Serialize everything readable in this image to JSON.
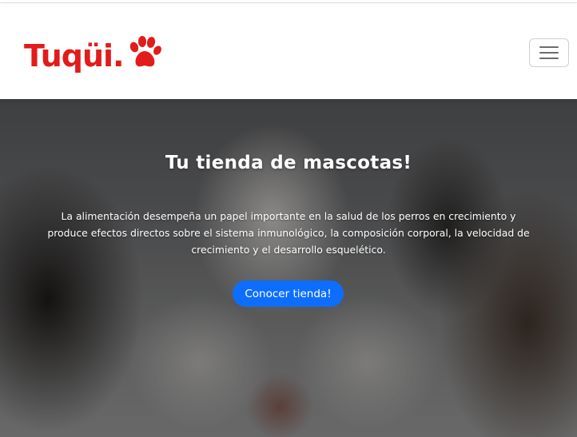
{
  "brand": {
    "name": "Tuqüi.",
    "logo_icon": "paw-icon",
    "color": "#e21b1b"
  },
  "navbar": {
    "toggle_icon": "hamburger-menu-icon"
  },
  "hero": {
    "title": "Tu tienda de mascotas!",
    "description": "La alimentación desempeña un papel importante en la salud de los perros en crecimiento y produce efectos directos sobre el sistema inmunológico, la composición corporal, la velocidad de crecimiento y el desarrollo esquelético.",
    "button_label": "Conocer tienda!",
    "button_color": "#0d6efd",
    "background_image": "blurred-cat-and-dogs-photo"
  }
}
